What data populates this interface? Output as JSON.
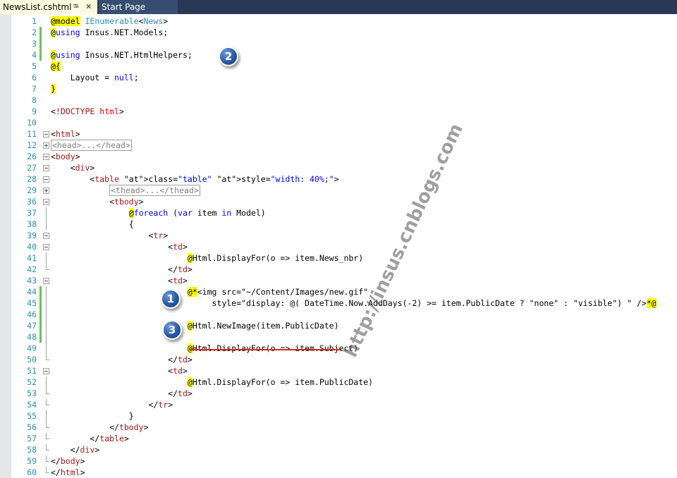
{
  "tabs": {
    "active": {
      "title": "NewsList.cshtml",
      "pin_icon": "pin-icon",
      "close_icon": "close-icon"
    },
    "inactive": [
      {
        "title": "Start Page"
      }
    ]
  },
  "editor": {
    "language": "Razor (cshtml)",
    "colors": {
      "keyword": "#0000ff",
      "tag": "#a31515",
      "attribute": "#ff0000",
      "type": "#2b91af",
      "razor_highlight": "#ffff00",
      "modified_bar": "#6ac259"
    },
    "lines": [
      {
        "n": "1",
        "text": "@model IEnumerable<News>",
        "fold": "none",
        "modified": false
      },
      {
        "n": "2",
        "text": "@using Insus.NET.Models;",
        "fold": "none",
        "modified": true
      },
      {
        "n": "3",
        "text": "",
        "fold": "none",
        "modified": true
      },
      {
        "n": "4",
        "text": "@using Insus.NET.HtmlHelpers;",
        "fold": "none",
        "modified": true
      },
      {
        "n": "5",
        "text": "@{",
        "fold": "none",
        "modified": false
      },
      {
        "n": "6",
        "text": "    Layout = null;",
        "fold": "none",
        "modified": false
      },
      {
        "n": "7",
        "text": "}",
        "fold": "none",
        "modified": false
      },
      {
        "n": "8",
        "text": "",
        "fold": "none",
        "modified": false
      },
      {
        "n": "9",
        "text": "<!DOCTYPE html>",
        "fold": "none",
        "modified": false
      },
      {
        "n": "10",
        "text": "",
        "fold": "none",
        "modified": false
      },
      {
        "n": "11",
        "text": "<html>",
        "fold": "open",
        "modified": false
      },
      {
        "n": "12",
        "text": "<head>...</head>",
        "fold": "collapsed",
        "modified": false
      },
      {
        "n": "26",
        "text": "<body>",
        "fold": "open",
        "modified": false
      },
      {
        "n": "27",
        "text": "    <div>",
        "fold": "open",
        "modified": false
      },
      {
        "n": "28",
        "text": "        <table class=\"table\" style=\"width: 40%;\">",
        "fold": "open",
        "modified": false
      },
      {
        "n": "29",
        "text": "            <thead>...</thead>",
        "fold": "collapsed",
        "modified": false
      },
      {
        "n": "36",
        "text": "            <tbody>",
        "fold": "open",
        "modified": false
      },
      {
        "n": "37",
        "text": "                @foreach (var item in Model)",
        "fold": "line",
        "modified": false
      },
      {
        "n": "38",
        "text": "                {",
        "fold": "line",
        "modified": false
      },
      {
        "n": "39",
        "text": "                    <tr>",
        "fold": "open",
        "modified": false
      },
      {
        "n": "40",
        "text": "                        <td>",
        "fold": "open",
        "modified": false
      },
      {
        "n": "41",
        "text": "                            @Html.DisplayFor(o => item.News_nbr)",
        "fold": "line",
        "modified": false
      },
      {
        "n": "42",
        "text": "                        </td>",
        "fold": "end",
        "modified": false
      },
      {
        "n": "43",
        "text": "                        <td>",
        "fold": "open",
        "modified": false
      },
      {
        "n": "44",
        "text": "                            @*<img src=\"~/Content/Images/new.gif\"",
        "fold": "line",
        "modified": true
      },
      {
        "n": "45",
        "text": "                                 style=\"display: @( DateTime.Now.AddDays(-2) >= item.PublicDate ? \"none\" : \"visible\") \" />*@",
        "fold": "line",
        "modified": true
      },
      {
        "n": "46",
        "text": "",
        "fold": "line",
        "modified": true
      },
      {
        "n": "47",
        "text": "                            @Html.NewImage(item.PublicDate)",
        "fold": "line",
        "modified": true
      },
      {
        "n": "48",
        "text": "",
        "fold": "line",
        "modified": true
      },
      {
        "n": "49",
        "text": "                            @Html.DisplayFor(o => item.Subject)",
        "fold": "line",
        "modified": false
      },
      {
        "n": "50",
        "text": "                        </td>",
        "fold": "end",
        "modified": false
      },
      {
        "n": "51",
        "text": "                        <td>",
        "fold": "open",
        "modified": false
      },
      {
        "n": "52",
        "text": "                            @Html.DisplayFor(o => item.PublicDate)",
        "fold": "line",
        "modified": false
      },
      {
        "n": "53",
        "text": "                        </td>",
        "fold": "end",
        "modified": false
      },
      {
        "n": "54",
        "text": "                    </tr>",
        "fold": "end",
        "modified": false
      },
      {
        "n": "55",
        "text": "                }",
        "fold": "line",
        "modified": false
      },
      {
        "n": "56",
        "text": "            </tbody>",
        "fold": "end",
        "modified": false
      },
      {
        "n": "57",
        "text": "        </table>",
        "fold": "end",
        "modified": false
      },
      {
        "n": "58",
        "text": "    </div>",
        "fold": "end",
        "modified": false
      },
      {
        "n": "59",
        "text": "</body>",
        "fold": "end",
        "modified": false
      },
      {
        "n": "60",
        "text": "</html>",
        "fold": "end",
        "modified": false
      }
    ]
  },
  "callouts": [
    {
      "label": "1"
    },
    {
      "label": "2"
    },
    {
      "label": "3"
    }
  ],
  "watermark": {
    "text": "http://insus.cnblogs.com"
  }
}
